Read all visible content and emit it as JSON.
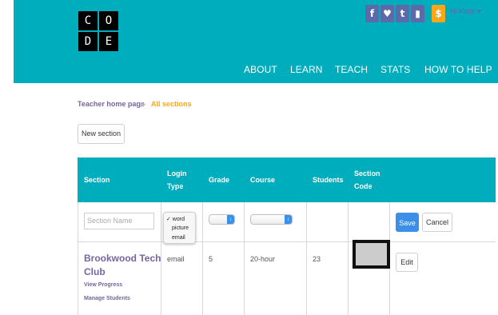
{
  "header": {
    "logo_letters": [
      "C",
      "O",
      "D",
      "E"
    ],
    "social": [
      {
        "glyph": "f",
        "name": "facebook-icon",
        "color": "#5d6aa9"
      },
      {
        "glyph": "♥",
        "name": "twitter-icon",
        "color": "#5d6aa9"
      },
      {
        "glyph": "t",
        "name": "tumblr-icon",
        "color": "#5d6aa9"
      },
      {
        "glyph": "▮",
        "name": "shirt-icon",
        "color": "#5d6aa9"
      },
      {
        "glyph": "$",
        "name": "donate-icon",
        "color": "#f7a71c"
      }
    ],
    "greeting": "Hi Katie ▾",
    "nav": [
      "ABOUT",
      "LEARN",
      "TEACH",
      "STATS",
      "HOW TO HELP"
    ]
  },
  "breadcrumb": {
    "home": "Teacher home page",
    "separator": "▶",
    "current": "All sections"
  },
  "new_section_label": "New section",
  "table": {
    "headers": {
      "section": "Section",
      "login_type": [
        "Login",
        "Type"
      ],
      "grade": "Grade",
      "course": "Course",
      "students": "Students",
      "section_code": [
        "Section",
        "Code"
      ]
    },
    "new_row": {
      "name_placeholder": "Section Name",
      "login_options": [
        "✓ word",
        "picture",
        "email"
      ],
      "save_label": "Save",
      "cancel_label": "Cancel"
    },
    "rows": [
      {
        "name_line1": "Brookwood Tech",
        "name_line2": "Club",
        "view_progress": "View Progress",
        "manage_students": "Manage Students",
        "login_type": "email",
        "grade": "5",
        "course": "20-hour",
        "students": "23",
        "edit_label": "Edit"
      }
    ]
  },
  "colors": {
    "brand": "#00adbc",
    "purple": "#7665a0",
    "orange": "#f7a71c"
  }
}
